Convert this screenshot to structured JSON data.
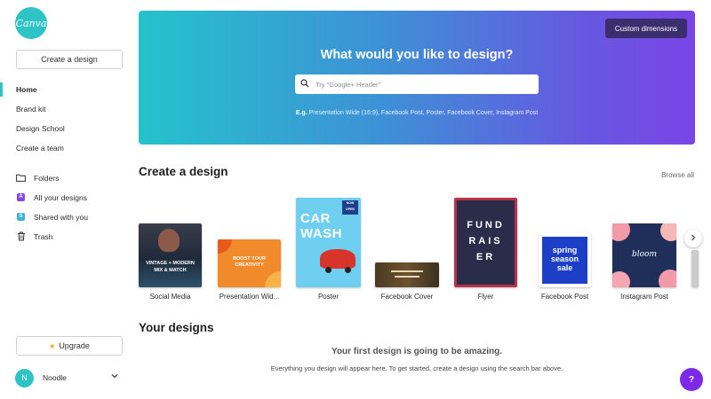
{
  "sidebar": {
    "logo_text": "Canva",
    "create_label": "Create a design",
    "nav": [
      {
        "label": "Home"
      },
      {
        "label": "Brand kit"
      },
      {
        "label": "Design School"
      },
      {
        "label": "Create a team"
      }
    ],
    "nav2": [
      {
        "label": "Folders",
        "icon": "folder-icon"
      },
      {
        "label": "All your designs",
        "icon": "designs-icon",
        "badge": "A"
      },
      {
        "label": "Shared with you",
        "icon": "shared-icon",
        "badge": "S"
      },
      {
        "label": "Trash",
        "icon": "trash-icon"
      }
    ],
    "upgrade_label": "Upgrade",
    "user": {
      "initial": "N",
      "name": "Noodle"
    }
  },
  "hero": {
    "custom_dimensions": "Custom dimensions",
    "title": "What would you like to design?",
    "search_placeholder": "Try \"Google+ Header\"",
    "examples_prefix": "E.g.",
    "examples": "Presentation Wide (16:9), Facebook Post, Poster, Facebook Cover, Instagram Post"
  },
  "create_section": {
    "title": "Create a design",
    "browse_all": "Browse all",
    "items": [
      {
        "label": "Social Media",
        "thumb_lines": [
          "VINTAGE + MODERN",
          "MIX & MATCH"
        ]
      },
      {
        "label": "Presentation Wid...",
        "thumb_lines": [
          "BOOST YOUR",
          "CREATIVITY"
        ]
      },
      {
        "label": "Poster",
        "thumb_lines": [
          "CAR",
          "WASH",
          "NOW",
          "OPEN"
        ]
      },
      {
        "label": "Facebook Cover",
        "thumb_lines": []
      },
      {
        "label": "Flyer",
        "thumb_lines": [
          "FUND",
          "RAIS",
          "ER"
        ]
      },
      {
        "label": "Facebook Post",
        "thumb_lines": [
          "spring",
          "season",
          "sale"
        ]
      },
      {
        "label": "Instagram Post",
        "thumb_lines": [
          "bloom"
        ]
      }
    ]
  },
  "your_designs": {
    "title": "Your designs",
    "empty_title": "Your first design is going to be amazing.",
    "empty_subtitle": "Everything you design will appear here. To get started, create a design using the search bar above."
  },
  "help": {
    "label": "?"
  },
  "colors": {
    "accent": "#2ec4c6",
    "purple": "#7d2ae8",
    "hero_start": "#25c3cc",
    "hero_end": "#7a45e6"
  }
}
